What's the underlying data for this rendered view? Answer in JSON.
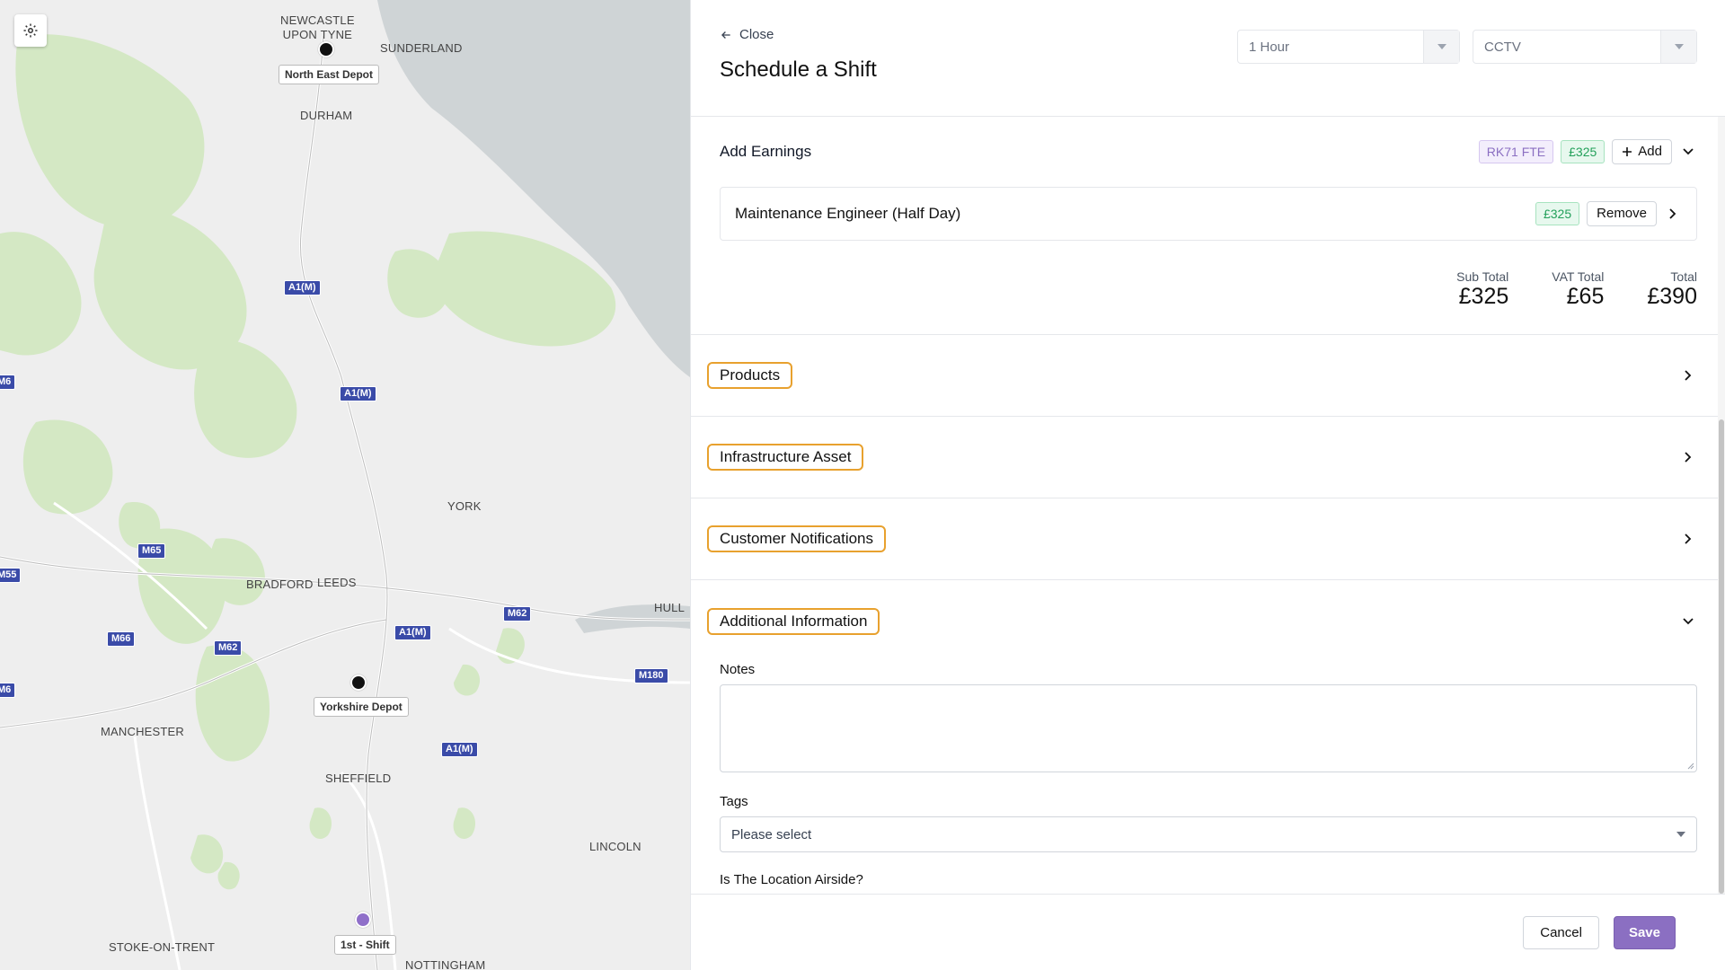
{
  "map": {
    "places": [
      {
        "name": "NEWCASTLE\nUPON TYNE"
      },
      {
        "name": "SUNDERLAND"
      },
      {
        "name": "DURHAM"
      },
      {
        "name": "YORK"
      },
      {
        "name": "BRADFORD"
      },
      {
        "name": "LEEDS"
      },
      {
        "name": "HULL"
      },
      {
        "name": "MANCHESTER"
      },
      {
        "name": "SHEFFIELD"
      },
      {
        "name": "LINCOLN"
      },
      {
        "name": "STOKE-ON-TRENT"
      },
      {
        "name": "NOTTINGHAM"
      }
    ],
    "roads": [
      "A1(M)",
      "A1(M)",
      "M6",
      "M65",
      "M55",
      "M66",
      "M62",
      "A1(M)",
      "M62",
      "M6",
      "M180",
      "A1(M)"
    ],
    "pins": [
      {
        "label": "North East Depot",
        "type": "depot"
      },
      {
        "label": "Yorkshire Depot",
        "type": "depot"
      },
      {
        "label": "1st - Shift",
        "type": "shift"
      }
    ],
    "colors": {
      "land": "#eeeeee",
      "sea": "#cfd4d6",
      "forest": "#d4e8c4"
    }
  },
  "header": {
    "close_label": "Close",
    "title": "Schedule a Shift",
    "duration_select": "1 Hour",
    "service_select": "CCTV"
  },
  "earnings": {
    "title": "Add Earnings",
    "vehicle_chip": "RK71 FTE",
    "amount_chip": "£325",
    "add_label": "Add",
    "row": {
      "name": "Maintenance Engineer (Half Day)",
      "amount": "£325",
      "remove_label": "Remove"
    },
    "subtotal_label": "Sub Total",
    "subtotal": "£325",
    "vat_label": "VAT Total",
    "vat": "£65",
    "total_label": "Total",
    "total": "£390"
  },
  "sections": {
    "products": "Products",
    "infrastructure": "Infrastructure Asset",
    "notifications": "Customer Notifications",
    "additional": "Additional Information"
  },
  "additional": {
    "notes_label": "Notes",
    "notes_value": "",
    "tags_label": "Tags",
    "tags_placeholder": "Please select",
    "airside_label": "Is The Location Airside?"
  },
  "footer": {
    "cancel_label": "Cancel",
    "save_label": "Save"
  },
  "theme": {
    "accent": "#8b6fc2",
    "highlight": "#e8a12e",
    "green": "#23a05a"
  }
}
